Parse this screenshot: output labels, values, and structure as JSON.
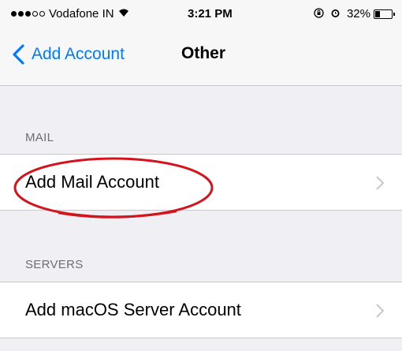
{
  "status_bar": {
    "carrier": "Vodafone IN",
    "wifi_icon": "wifi-icon",
    "time": "3:21 PM",
    "lock_icon": "orientation-lock-icon",
    "alarm_icon": "alarm-icon",
    "battery_percent": "32%",
    "battery_level": 0.32,
    "signal_full": 3,
    "signal_total": 5
  },
  "nav": {
    "back_label": "Add Account",
    "title": "Other"
  },
  "sections": {
    "mail": {
      "header": "MAIL",
      "item_label": "Add Mail Account"
    },
    "servers": {
      "header": "SERVERS",
      "item_label": "Add macOS Server Account"
    }
  },
  "colors": {
    "accent": "#007aff",
    "highlight": "#d4141c",
    "background": "#efeff4"
  }
}
